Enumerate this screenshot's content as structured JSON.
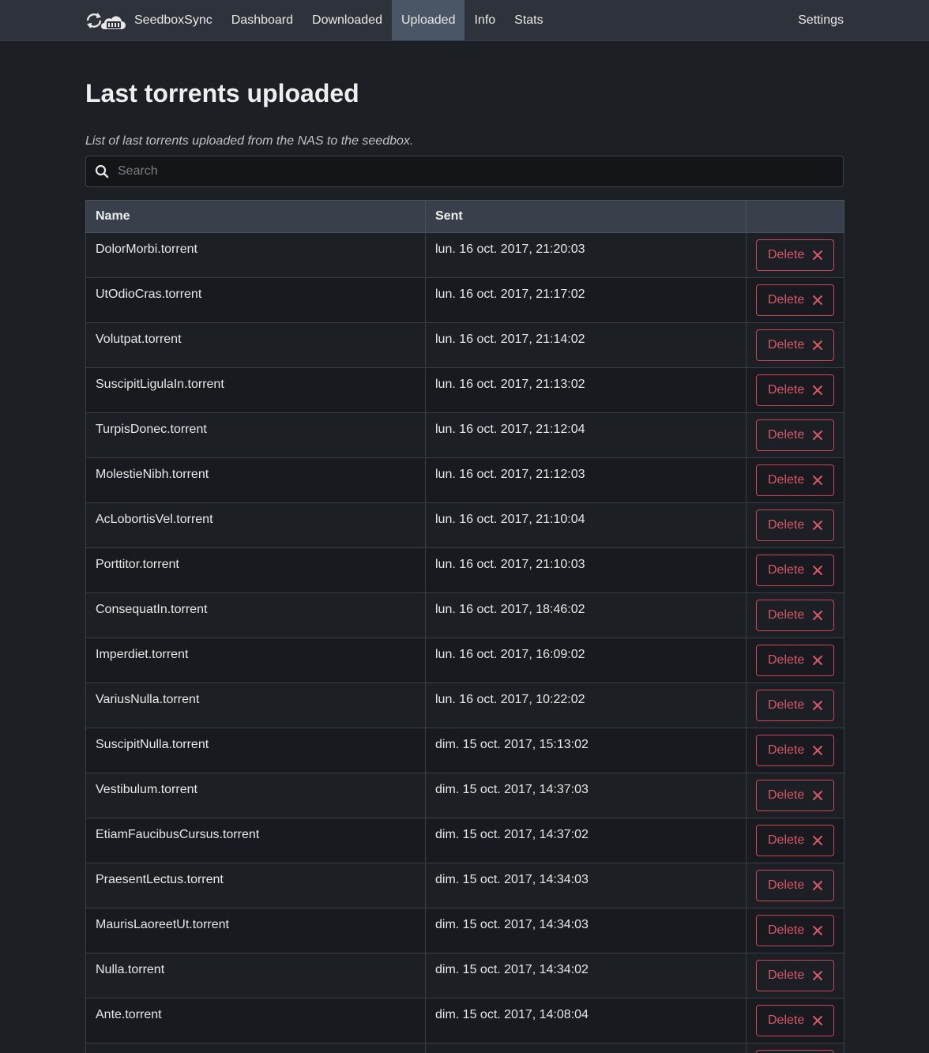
{
  "navbar": {
    "brand": "SeedboxSync",
    "links": [
      {
        "label": "Dashboard",
        "active": false
      },
      {
        "label": "Downloaded",
        "active": false
      },
      {
        "label": "Uploaded",
        "active": true
      },
      {
        "label": "Info",
        "active": false
      },
      {
        "label": "Stats",
        "active": false
      }
    ],
    "settings_label": "Settings"
  },
  "page": {
    "title": "Last torrents uploaded",
    "subtitle": "List of last torrents uploaded from the NAS to the seedbox."
  },
  "search": {
    "placeholder": "Search",
    "value": ""
  },
  "table": {
    "columns": [
      "Name",
      "Sent",
      ""
    ],
    "delete_label": "Delete",
    "rows": [
      {
        "name": "DolorMorbi.torrent",
        "sent": "lun. 16 oct. 2017, 21:20:03"
      },
      {
        "name": "UtOdioCras.torrent",
        "sent": "lun. 16 oct. 2017, 21:17:02"
      },
      {
        "name": "Volutpat.torrent",
        "sent": "lun. 16 oct. 2017, 21:14:02"
      },
      {
        "name": "SuscipitLigulaIn.torrent",
        "sent": "lun. 16 oct. 2017, 21:13:02"
      },
      {
        "name": "TurpisDonec.torrent",
        "sent": "lun. 16 oct. 2017, 21:12:04"
      },
      {
        "name": "MolestieNibh.torrent",
        "sent": "lun. 16 oct. 2017, 21:12:03"
      },
      {
        "name": "AcLobortisVel.torrent",
        "sent": "lun. 16 oct. 2017, 21:10:04"
      },
      {
        "name": "Porttitor.torrent",
        "sent": "lun. 16 oct. 2017, 21:10:03"
      },
      {
        "name": "ConsequatIn.torrent",
        "sent": "lun. 16 oct. 2017, 18:46:02"
      },
      {
        "name": "Imperdiet.torrent",
        "sent": "lun. 16 oct. 2017, 16:09:02"
      },
      {
        "name": "VariusNulla.torrent",
        "sent": "lun. 16 oct. 2017, 10:22:02"
      },
      {
        "name": "SuscipitNulla.torrent",
        "sent": "dim. 15 oct. 2017, 15:13:02"
      },
      {
        "name": "Vestibulum.torrent",
        "sent": "dim. 15 oct. 2017, 14:37:03"
      },
      {
        "name": "EtiamFaucibusCursus.torrent",
        "sent": "dim. 15 oct. 2017, 14:37:02"
      },
      {
        "name": "PraesentLectus.torrent",
        "sent": "dim. 15 oct. 2017, 14:34:03"
      },
      {
        "name": "MaurisLaoreetUt.torrent",
        "sent": "dim. 15 oct. 2017, 14:34:03"
      },
      {
        "name": "Nulla.torrent",
        "sent": "dim. 15 oct. 2017, 14:34:02"
      },
      {
        "name": "Ante.torrent",
        "sent": "dim. 15 oct. 2017, 14:08:04"
      },
      {
        "name": "",
        "sent": ""
      }
    ]
  },
  "colors": {
    "background": "#1c1f24",
    "navbar": "#2e323a",
    "nav_active": "#4a5565",
    "table_header": "#39404b",
    "danger": "#d8576a"
  }
}
